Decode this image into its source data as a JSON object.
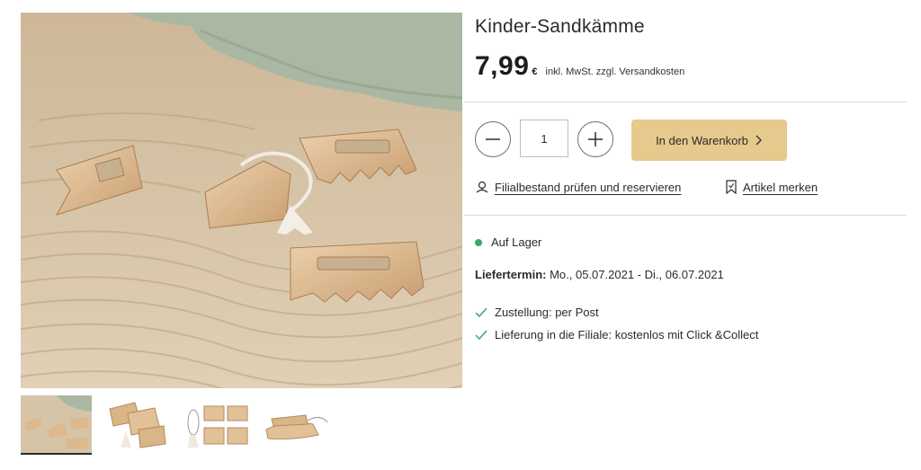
{
  "product": {
    "title": "Kinder-Sandkämme",
    "price": "7,99",
    "currency": "€",
    "tax_note": "inkl. MwSt. zzgl. Versandkosten"
  },
  "quantity": {
    "value": "1",
    "minus_icon": "minus-icon",
    "plus_icon": "plus-icon"
  },
  "cart": {
    "label": "In den Warenkorb",
    "icon": "chevron-right-icon"
  },
  "links": {
    "store_check": "Filialbestand prüfen und reservieren",
    "store_icon": "location-pin-icon",
    "favorite": "Artikel merken",
    "favorite_icon": "bookmark-icon"
  },
  "availability": {
    "status": "Auf Lager",
    "status_color": "#3aa66b"
  },
  "delivery": {
    "label": "Liefertermin:",
    "range": "Mo., 05.07.2021 - Di., 06.07.2021"
  },
  "shipping_options": [
    "Zustellung: per Post",
    "Lieferung in die Filiale: kostenlos mit Click &Collect"
  ],
  "colors": {
    "accent": "#e6c98d",
    "text": "#2b2b2b",
    "check": "#3aa66b"
  }
}
